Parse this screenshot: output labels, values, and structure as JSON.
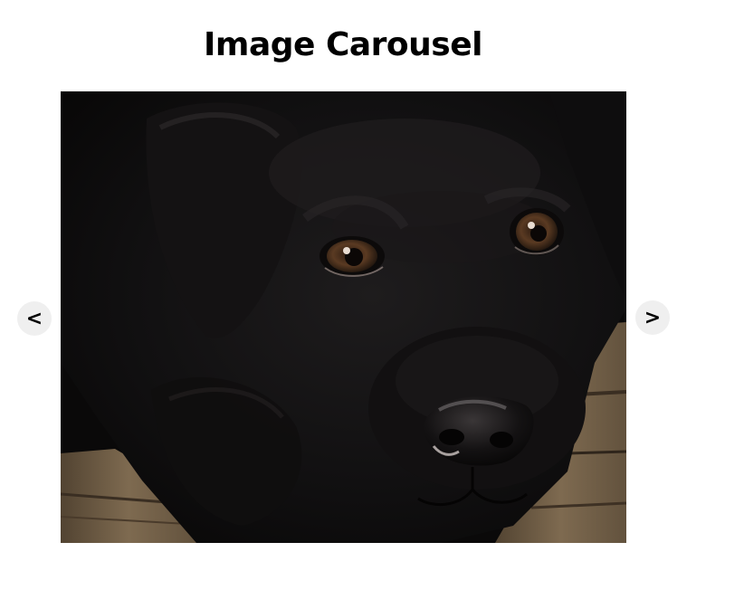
{
  "page": {
    "title": "Image Carousel"
  },
  "carousel": {
    "prev_label": "<",
    "next_label": ">",
    "current_image": {
      "subject": "black labrador puppy lying on wooden floor",
      "icon": "photo"
    }
  },
  "colors": {
    "background": "#ffffff",
    "button_bg": "#efefef",
    "text": "#000000"
  }
}
